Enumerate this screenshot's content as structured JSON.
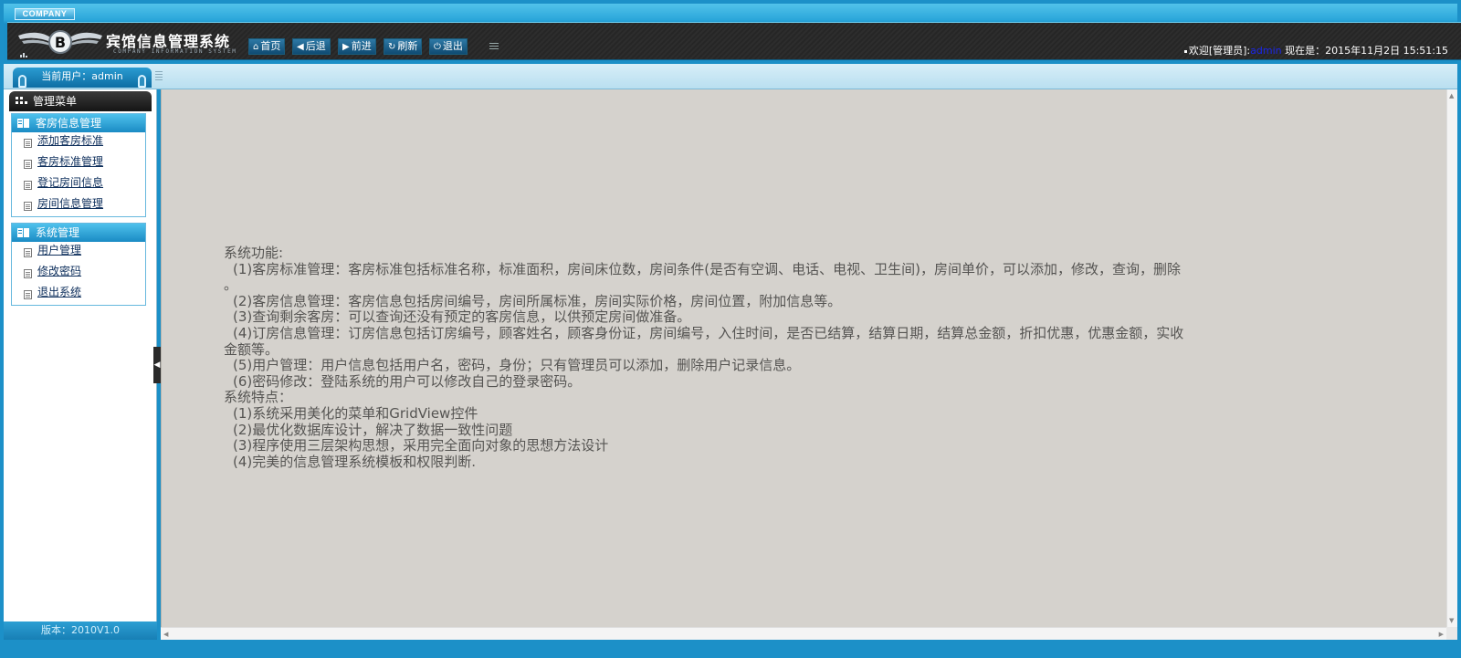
{
  "header": {
    "company_badge": "COMPANY",
    "title": "宾馆信息管理系统",
    "subtitle": "COMPANY INFORMATION SYSTEM",
    "buttons": [
      {
        "label": "首页",
        "icon": "home-icon"
      },
      {
        "label": "后退",
        "icon": "arrow-left-icon"
      },
      {
        "label": "前进",
        "icon": "arrow-right-icon"
      },
      {
        "label": "刷新",
        "icon": "refresh-icon"
      },
      {
        "label": "退出",
        "icon": "power-icon"
      }
    ],
    "welcome_prefix": "欢迎[管理员]:",
    "welcome_user": "admin",
    "time_label": "现在是：2015年11月2日 15:51:15"
  },
  "subbar": {
    "current_user": "当前用户：admin"
  },
  "sidebar": {
    "menu_title": "管理菜单",
    "sections": [
      {
        "title": "客房信息管理",
        "items": [
          "添加客房标准",
          "客房标准管理",
          "登记房间信息",
          "房间信息管理"
        ]
      },
      {
        "title": "系统管理",
        "items": [
          "用户管理",
          "修改密码",
          "退出系统"
        ]
      }
    ],
    "version": "版本：2010V1.0"
  },
  "content": {
    "lines": [
      {
        "text": "系统功能:",
        "indent": false
      },
      {
        "text": "(1)客房标准管理：客房标准包括标准名称，标准面积，房间床位数，房间条件(是否有空调、电话、电视、卫生间)，房间单价，可以添加，修改，查询，删除",
        "indent": true
      },
      {
        "text": "。",
        "indent": false
      },
      {
        "text": "(2)客房信息管理：客房信息包括房间编号，房间所属标准，房间实际价格，房间位置，附加信息等。",
        "indent": true
      },
      {
        "text": "(3)查询剩余客房：可以查询还没有预定的客房信息，以供预定房间做准备。",
        "indent": true
      },
      {
        "text": "(4)订房信息管理：订房信息包括订房编号，顾客姓名，顾客身份证，房间编号，入住时间，是否已结算，结算日期，结算总金额，折扣优惠，优惠金额，实收",
        "indent": true
      },
      {
        "text": "金额等。",
        "indent": false
      },
      {
        "text": "(5)用户管理：用户信息包括用户名，密码，身份；只有管理员可以添加，删除用户记录信息。",
        "indent": true
      },
      {
        "text": "(6)密码修改：登陆系统的用户可以修改自己的登录密码。",
        "indent": true
      },
      {
        "text": "系统特点：",
        "indent": false
      },
      {
        "text": "(1)系统采用美化的菜单和GridView控件",
        "indent": true
      },
      {
        "text": "(2)最优化数据库设计，解决了数据一致性问题",
        "indent": true
      },
      {
        "text": "(3)程序使用三层架构思想，采用完全面向对象的思想方法设计",
        "indent": true
      },
      {
        "text": "(4)完美的信息管理系统模板和权限判断.",
        "indent": true
      }
    ]
  },
  "colors": {
    "frame_blue": "#1c90c8",
    "content_bg": "#d5d2cd",
    "username_blue": "#1a26e8"
  }
}
